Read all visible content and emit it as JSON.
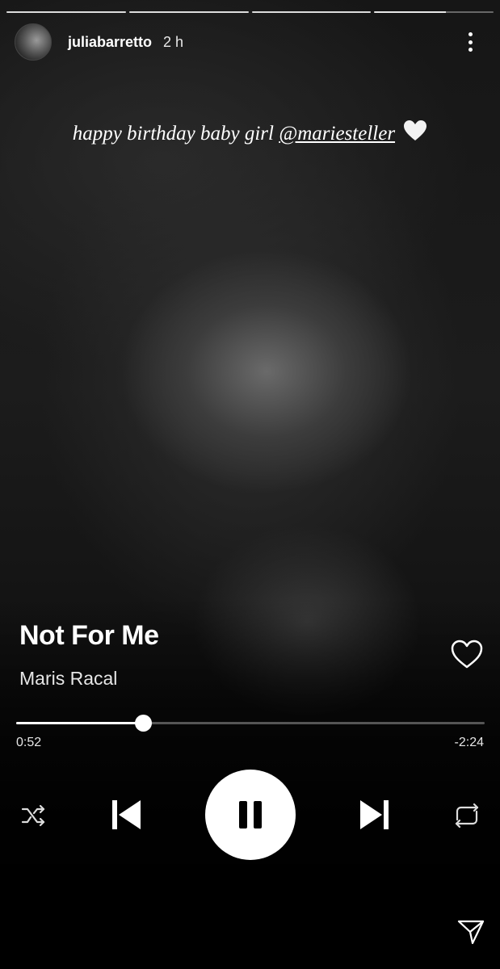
{
  "story": {
    "username": "juliabarretto",
    "time_ago": "2 h",
    "progress_segments": [
      1,
      1,
      1,
      1
    ],
    "caption": {
      "text": "happy birthday baby girl",
      "mention": "@mariesteller",
      "emoji": "white-heart-icon"
    }
  },
  "player": {
    "track_title": "Not For Me",
    "artist": "Maris Racal",
    "elapsed": "0:52",
    "remaining": "-2:24",
    "progress_fraction": 0.27,
    "state": "playing",
    "icons": [
      "heart-icon",
      "shuffle-icon",
      "previous-icon",
      "pause-icon",
      "next-icon",
      "repeat-icon",
      "send-icon",
      "more-options-icon"
    ]
  },
  "colors": {
    "background": "#000000",
    "text": "#ffffff",
    "track_unfilled": "#555555"
  }
}
